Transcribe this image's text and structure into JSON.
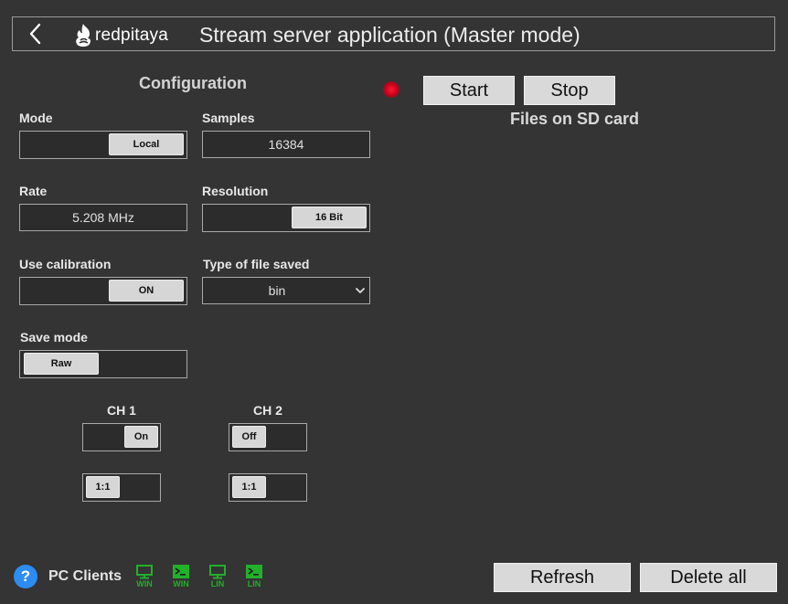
{
  "header": {
    "title": "Stream server application (Master mode)",
    "logo_text": "redpitaya",
    "back_icon": "chevron-left-icon",
    "logo_icon": "red-pitaya-logo-icon"
  },
  "config": {
    "title": "Configuration",
    "mode": {
      "label": "Mode",
      "value": "Local"
    },
    "samples": {
      "label": "Samples",
      "value": "16384"
    },
    "rate": {
      "label": "Rate",
      "value": "5.208 MHz"
    },
    "resolution": {
      "label": "Resolution",
      "value": "16 Bit"
    },
    "calibration": {
      "label": "Use calibration",
      "value": "ON"
    },
    "file_type": {
      "label": "Type of file saved",
      "value": "bin"
    },
    "save_mode": {
      "label": "Save mode",
      "value": "Raw"
    },
    "ch1": {
      "label": "CH 1",
      "state": "On",
      "attenuation": "1:1"
    },
    "ch2": {
      "label": "CH 2",
      "state": "Off",
      "attenuation": "1:1"
    }
  },
  "controls": {
    "start_label": "Start",
    "stop_label": "Stop",
    "status_led_color": "#e8002a",
    "files_title": "Files on SD card"
  },
  "footer": {
    "help_glyph": "?",
    "pc_clients_label": "PC Clients",
    "clients": [
      {
        "icon": "monitor-icon",
        "caption": "WIN"
      },
      {
        "icon": "terminal-icon",
        "caption": "WIN"
      },
      {
        "icon": "monitor-icon",
        "caption": "LIN"
      },
      {
        "icon": "terminal-icon",
        "caption": "LIN"
      }
    ],
    "refresh_label": "Refresh",
    "delete_all_label": "Delete all"
  },
  "colors": {
    "background": "#343434",
    "client_icon_green": "#22b02a",
    "help_blue": "#2d8cf0"
  }
}
